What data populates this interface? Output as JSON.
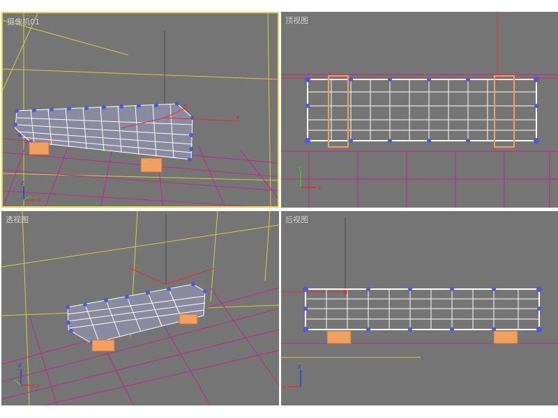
{
  "viewports": {
    "camera": {
      "label": "摄像机01"
    },
    "top": {
      "label": "顶视图"
    },
    "perspective": {
      "label": "透视图"
    },
    "back": {
      "label": "后视图"
    }
  },
  "axis": {
    "x": "x",
    "y": "y",
    "z": "z"
  },
  "colors": {
    "background": "#757575",
    "active_border": "#e8d44a",
    "grid": "#c0288a",
    "camera_frame": "#d7cd3c",
    "mesh_wire": "#ffffff",
    "vertex": "#4f56e0",
    "leg": "#f0a060",
    "gizmo_x": "#e23030",
    "gizmo_y": "#2fd02f",
    "gizmo_z": "#2f3fe0"
  }
}
